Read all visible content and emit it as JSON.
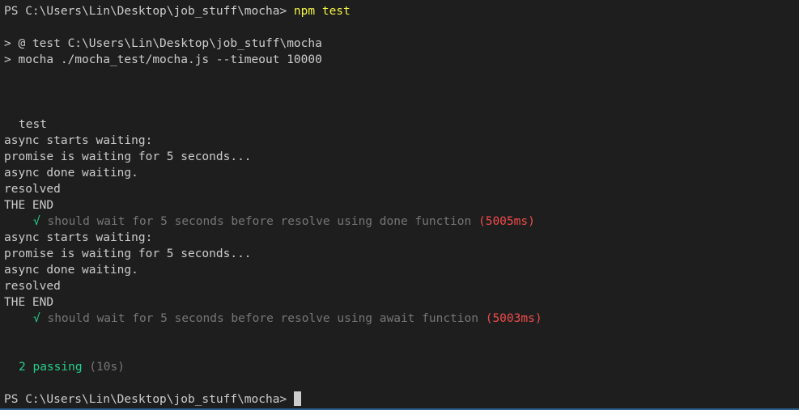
{
  "terminal": {
    "prompt1": "PS C:\\Users\\Lin\\Desktop\\job_stuff\\mocha> ",
    "command1": "npm test",
    "npm_line1": "> @ test C:\\Users\\Lin\\Desktop\\job_stuff\\mocha",
    "npm_line2": "> mocha ./mocha_test/mocha.js --timeout 10000",
    "suite_title": "test",
    "run1": {
      "log1": "async starts waiting:",
      "log2": "promise is waiting for 5 seconds...",
      "log3": "async done waiting.",
      "log4": "resolved",
      "log5": "THE END",
      "check": "√",
      "test_title": " should wait for 5 seconds before resolve using done function ",
      "duration": "(5005ms)"
    },
    "run2": {
      "log1": "async starts waiting:",
      "log2": "promise is waiting for 5 seconds...",
      "log3": "async done waiting.",
      "log4": "resolved",
      "log5": "THE END",
      "check": "√",
      "test_title": " should wait for 5 seconds before resolve using await function ",
      "duration": "(5003ms)"
    },
    "summary_passing": "2 passing",
    "summary_time": " (10s)",
    "prompt2": "PS C:\\Users\\Lin\\Desktop\\job_stuff\\mocha> ",
    "colors": {
      "background": "#1e1e1e",
      "text": "#cccccc",
      "command": "#f5f543",
      "success": "#23d18b",
      "muted": "#767676",
      "slow": "#f14c4c"
    }
  }
}
